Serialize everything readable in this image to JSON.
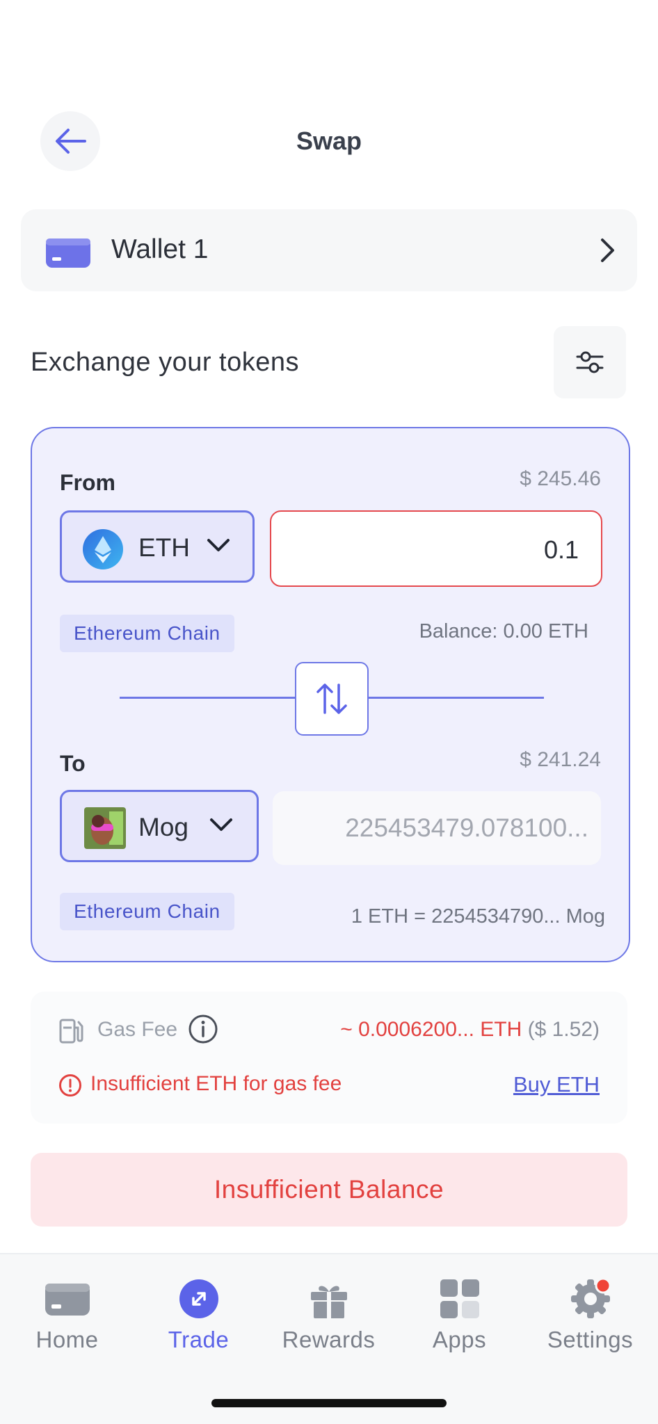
{
  "header": {
    "title": "Swap",
    "back_icon": "arrow-left-icon"
  },
  "wallet": {
    "name": "Wallet 1",
    "icon": "wallet-icon"
  },
  "exchange": {
    "label": "Exchange your tokens",
    "settings_icon": "sliders-icon"
  },
  "from": {
    "label": "From",
    "usd_value": "$ 245.46",
    "token": "ETH",
    "amount": "0.1",
    "chain": "Ethereum Chain",
    "balance": "Balance: 0.00 ETH"
  },
  "to": {
    "label": "To",
    "usd_value": "$ 241.24",
    "token": "Mog",
    "amount": "225453479.078100...",
    "chain": "Ethereum Chain",
    "rate": "1 ETH = 2254534790... Mog"
  },
  "gas": {
    "label": "Gas Fee",
    "value": "~ 0.0006200... ETH",
    "usd": "($ 1.52)",
    "warning": "Insufficient ETH for gas fee",
    "buy_link": "Buy ETH"
  },
  "action": {
    "label": "Insufficient Balance"
  },
  "nav": {
    "items": [
      {
        "label": "Home",
        "icon": "wallet-icon"
      },
      {
        "label": "Trade",
        "icon": "trade-icon",
        "active": true
      },
      {
        "label": "Rewards",
        "icon": "gift-icon"
      },
      {
        "label": "Apps",
        "icon": "apps-grid-icon"
      },
      {
        "label": "Settings",
        "icon": "gear-icon",
        "badge": true
      }
    ]
  },
  "colors": {
    "accent": "#5b63e8",
    "error": "#e2413f",
    "card_bg": "#f0f0fd"
  }
}
